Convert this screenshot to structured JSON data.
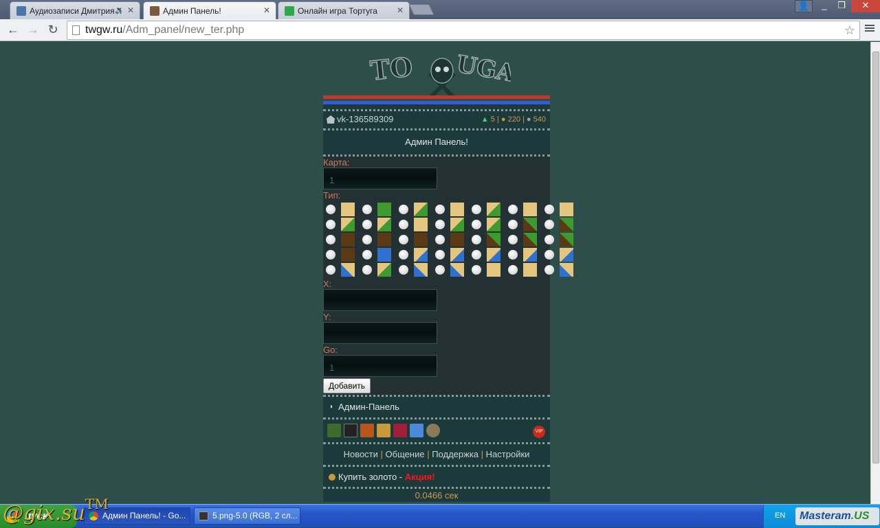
{
  "browser": {
    "tabs": [
      {
        "label": "Аудиозаписи Дмитрия К",
        "active": false
      },
      {
        "label": "Админ Панель!",
        "active": true
      },
      {
        "label": "Онлайн игра Тортуга",
        "active": false
      }
    ],
    "url_host": "twgw.ru",
    "url_path": "/Adm_panel/new_ter.php"
  },
  "colors": {
    "accent_orange": "#d07a52",
    "stripe_red": "#c0392b",
    "stripe_blue": "#3a5bd9",
    "promo_red": "#ff1414"
  },
  "game": {
    "logo_text": "TORTUGA",
    "user": {
      "name": "vk-136589309",
      "level": "5",
      "gold": "220",
      "silver": "540"
    },
    "title": "Админ Панель!",
    "form": {
      "map_label": "Карта:",
      "map_value": "1",
      "type_label": "Тип:",
      "x_label": "X:",
      "x_value": "",
      "y_label": "Y:",
      "y_value": "",
      "go_label": "Go:",
      "go_value": "1",
      "submit": "Добавить"
    },
    "tile_rows": [
      [
        "t-sand",
        "t-grass",
        "t-mix",
        "t-sand",
        "t-mix",
        "t-sand",
        "t-sand"
      ],
      [
        "t-mix",
        "t-mix",
        "t-sand",
        "t-mix",
        "t-mix",
        "t-mix2",
        "t-mix2"
      ],
      [
        "t-dirt",
        "t-dirt",
        "t-dirt",
        "t-dirt",
        "t-mix2",
        "t-mix2",
        "t-mix2"
      ],
      [
        "t-dirt",
        "t-water",
        "t-shore",
        "t-shore",
        "t-shore",
        "t-shore",
        "t-shore"
      ],
      [
        "t-shore2",
        "t-mix",
        "t-shore2",
        "t-shore2",
        "t-sand",
        "t-sand",
        "t-shore2"
      ]
    ],
    "menu": "Админ-Панель",
    "icons": [
      "helmet-icon",
      "pirate-icon",
      "sun-icon",
      "map-icon",
      "star-icon",
      "compass-icon",
      "skull-icon"
    ],
    "vip_label": "VIP",
    "links": [
      "Новости",
      "Общение",
      "Поддержка",
      "Настройки"
    ],
    "buy_text": "Купить золото -",
    "buy_promo": "Акция!",
    "timer": "0.0466 сек"
  },
  "taskbar": {
    "start": "пуск",
    "tasks": [
      "Админ Панель! - Go...",
      "5.png-5.0 (RGB, 2 сл..."
    ],
    "lang": "EN",
    "tray_brand_a": "Masteram",
    "tray_brand_b": ".US"
  },
  "watermark": {
    "text": "@gix.su",
    "tm": "TM"
  }
}
